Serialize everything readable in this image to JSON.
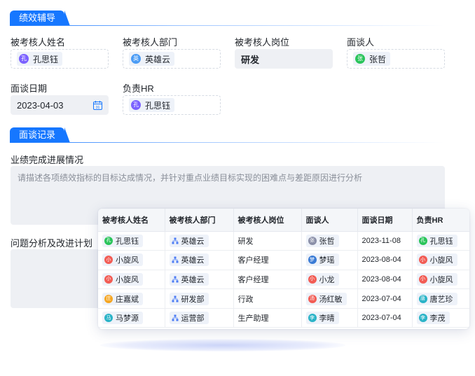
{
  "section_performance": {
    "title": "绩效辅导"
  },
  "fields": {
    "name": {
      "label": "被考核人姓名",
      "value": "孔思钰",
      "avatar": "孔",
      "color": "#7b61ff"
    },
    "dept": {
      "label": "被考核人部门",
      "value": "英雄云",
      "avatar": "英",
      "color": "#4b9cf5"
    },
    "post": {
      "label": "被考核人岗位",
      "value": "研发"
    },
    "interviewer": {
      "label": "面谈人",
      "value": "张哲",
      "avatar": "张",
      "color": "#29c45a"
    },
    "date": {
      "label": "面谈日期",
      "value": "2023-04-03"
    },
    "hr": {
      "label": "负责HR",
      "value": "孔思钰",
      "avatar": "孔",
      "color": "#7b61ff"
    }
  },
  "section_record": {
    "title": "面谈记录"
  },
  "progress": {
    "label": "业绩完成进展情况",
    "placeholder": "请描述各项绩效指标的目标达成情况，并针对重点业绩目标实现的困难点与差距原因进行分析"
  },
  "improvement": {
    "label": "问题分析及改进计划"
  },
  "table": {
    "headers": [
      "被考核人姓名",
      "被考核人部门",
      "被考核人岗位",
      "面谈人",
      "面谈日期",
      "负责HR"
    ],
    "rows": [
      {
        "name": "孔思钰",
        "name_av": "孔",
        "name_color": "#29c45a",
        "dept": "英雄云",
        "post": "研发",
        "interviewer": "张哲",
        "int_av": "张",
        "int_color": "#8a8fa8",
        "date": "2023-11-08",
        "hr": "孔思钰",
        "hr_av": "孔",
        "hr_color": "#29c45a"
      },
      {
        "name": "小旋风",
        "name_av": "小",
        "name_color": "#f25c54",
        "dept": "英雄云",
        "post": "客户经理",
        "interviewer": "梦瑶",
        "int_av": "梦",
        "int_color": "#3a7bd5",
        "date": "2023-08-04",
        "hr": "小旋风",
        "hr_av": "小",
        "hr_color": "#f25c54"
      },
      {
        "name": "小旋风",
        "name_av": "小",
        "name_color": "#f25c54",
        "dept": "英雄云",
        "post": "客户经理",
        "interviewer": "小龙",
        "int_av": "小",
        "int_color": "#f25c54",
        "date": "2023-08-04",
        "hr": "小旋风",
        "hr_av": "小",
        "hr_color": "#f25c54"
      },
      {
        "name": "庄嘉斌",
        "name_av": "庄",
        "name_color": "#f5a623",
        "dept": "研发部",
        "post": "行政",
        "interviewer": "汤红敏",
        "int_av": "汤",
        "int_color": "#f25c54",
        "date": "2023-07-04",
        "hr": "唐艺珍",
        "hr_av": "唐",
        "hr_color": "#2ab3c7"
      },
      {
        "name": "马梦源",
        "name_av": "马",
        "name_color": "#2ab3c7",
        "dept": "运营部",
        "post": "生产助理",
        "interviewer": "李晴",
        "int_av": "李",
        "int_color": "#2ab3c7",
        "date": "2023-07-04",
        "hr": "李茂",
        "hr_av": "李",
        "hr_color": "#2ab3c7"
      }
    ]
  },
  "colors": {
    "accent": "#1677ff"
  }
}
